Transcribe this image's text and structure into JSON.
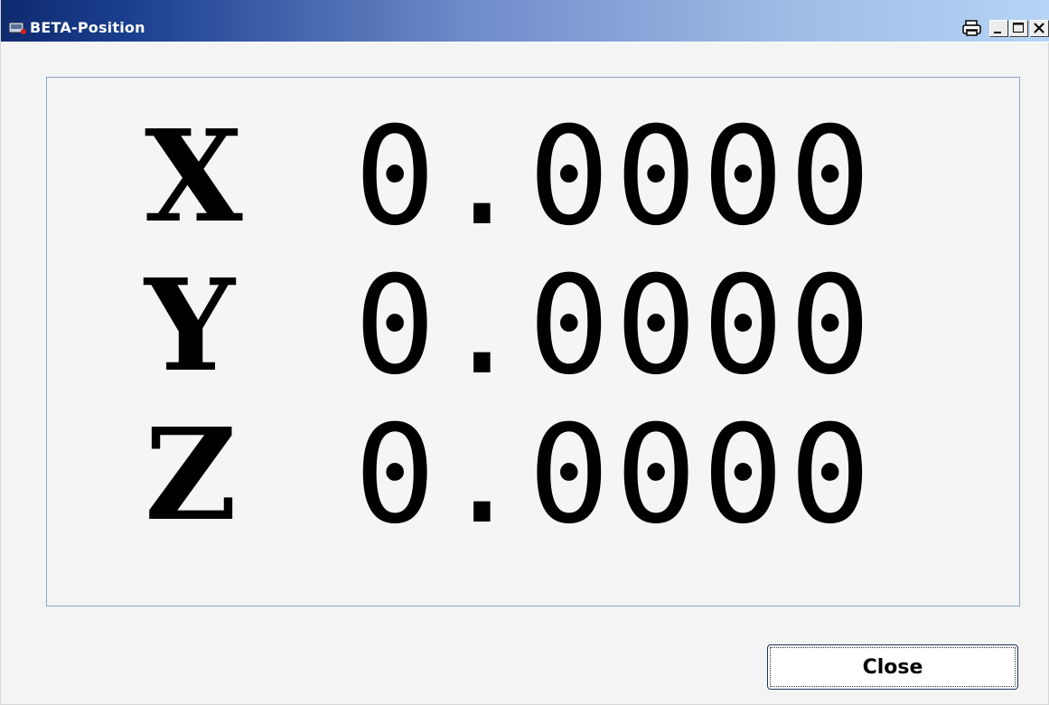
{
  "window": {
    "title": "BETA-Position"
  },
  "titlebar_buttons": {
    "print_icon": "printer-icon",
    "minimize_icon": "minimize-icon",
    "maximize_icon": "maximize-icon",
    "close_icon": "close-icon"
  },
  "axes": [
    {
      "label": "X",
      "value": "0.0000"
    },
    {
      "label": "Y",
      "value": "0.0000"
    },
    {
      "label": "Z",
      "value": "0.0000"
    }
  ],
  "footer": {
    "close_label": "Close"
  },
  "colors": {
    "titlebar_start": "#0e2a6e",
    "titlebar_end": "#b5d4f5",
    "panel_border": "#8ca6c8",
    "background": "#f4f4f4"
  }
}
